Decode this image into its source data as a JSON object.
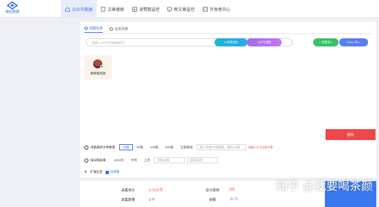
{
  "logo_text": "微信数据",
  "nav": [
    {
      "label": "公众号数据"
    },
    {
      "label": "文章搜索"
    },
    {
      "label": "读赞数监控"
    },
    {
      "label": "新文章监控"
    },
    {
      "label": "开发者中心"
    }
  ],
  "tabs": [
    "创建任务",
    "任务列表"
  ],
  "search_placeholder": "请输入公众号名称或微信号",
  "buttons": {
    "fast_add": "● 快速添加",
    "account_search": "公众号搜索",
    "batch_import": "+ 批量导入",
    "excel_import": "Excel 导入",
    "cancel": "删除"
  },
  "account_card": {
    "name": "我要喝茶颜"
  },
  "collect_count": {
    "label": "采集最新文章数量",
    "options": [
      "10篇",
      "50篇",
      "100篇",
      "500篇",
      "全部篇幅"
    ],
    "input_placeholder": "输入采集文章篇数，最多10篇",
    "hint": "采集公众号全部文章"
  },
  "collect_time": {
    "label": "按日期采集",
    "year": "2019年",
    "month": "半月",
    "select": "上月",
    "start": "开始日期",
    "end": "结束日期"
  },
  "extra": {
    "label": "扩展信息",
    "checkbox_label": "读赞数"
  },
  "bottom": {
    "unit_price_label": "采集单价",
    "unit_price_value": "1 /公众号",
    "total_cost_label": "总计费用",
    "total_cost_value": "100",
    "count_label": "采集数量",
    "count_value": "1 个",
    "balance_label": "余额",
    "balance_value": "11.71"
  },
  "watermark": "知乎 @我要喝茶颜"
}
